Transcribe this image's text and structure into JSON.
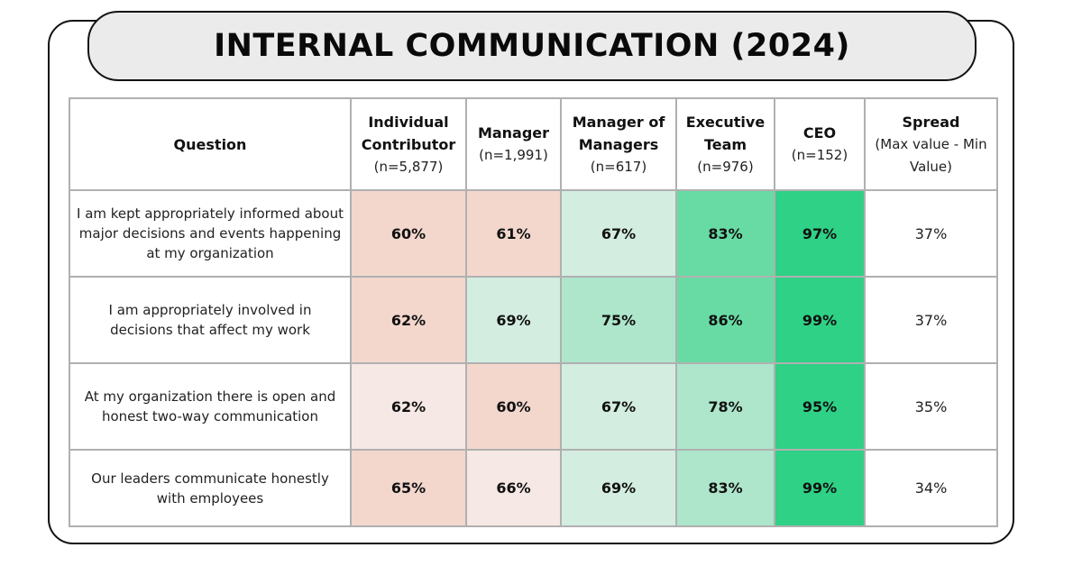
{
  "title": "INTERNAL COMMUNICATION (2024)",
  "colors": {
    "salmon": "#f3d7cd",
    "light_pink": "#f6e8e4",
    "pale_green": "#d3ede0",
    "mid_green": "#ade6cb",
    "green": "#68dba4",
    "strong_green": "#2ed185"
  },
  "columns": [
    {
      "name": "Question",
      "n": ""
    },
    {
      "name": "Individual Contributor",
      "n": "(n=5,877)"
    },
    {
      "name": "Manager",
      "n": "(n=1,991)"
    },
    {
      "name": "Manager of Managers",
      "n": "(n=617)"
    },
    {
      "name": "Executive Team",
      "n": "(n=976)"
    },
    {
      "name": "CEO",
      "n": "(n=152)"
    },
    {
      "name": "Spread",
      "n": "(Max value - Min Value)"
    }
  ],
  "rows": [
    {
      "question": "I am kept appropriately informed about major decisions and events happening at my organization",
      "values": [
        "60%",
        "61%",
        "67%",
        "83%",
        "97%"
      ],
      "colors": [
        "#f3d7cd",
        "#f3d7cd",
        "#d3ede0",
        "#68dba4",
        "#2ed185"
      ],
      "spread": "37%"
    },
    {
      "question": "I am appropriately involved in decisions that affect my work",
      "values": [
        "62%",
        "69%",
        "75%",
        "86%",
        "99%"
      ],
      "colors": [
        "#f3d7cd",
        "#d3ede0",
        "#ade6cb",
        "#68dba4",
        "#2ed185"
      ],
      "spread": "37%"
    },
    {
      "question": "At my organization there is open and honest two-way communication",
      "values": [
        "62%",
        "60%",
        "67%",
        "78%",
        "95%"
      ],
      "colors": [
        "#f6e8e4",
        "#f3d7cd",
        "#d3ede0",
        "#ade6cb",
        "#2ed185"
      ],
      "spread": "35%"
    },
    {
      "question": "Our leaders communicate honestly with employees",
      "values": [
        "65%",
        "66%",
        "69%",
        "83%",
        "99%"
      ],
      "colors": [
        "#f3d7cd",
        "#f6e8e4",
        "#d3ede0",
        "#ade6cb",
        "#2ed185"
      ],
      "spread": "34%"
    }
  ],
  "chart_data": {
    "type": "heatmap",
    "title": "INTERNAL COMMUNICATION (2024)",
    "x": [
      "Individual Contributor (n=5,877)",
      "Manager (n=1,991)",
      "Manager of Managers (n=617)",
      "Executive Team (n=976)",
      "CEO (n=152)"
    ],
    "y": [
      "I am kept appropriately informed about major decisions and events happening at my organization",
      "I am appropriately involved in decisions that affect my work",
      "At my organization there is open and honest two-way communication",
      "Our leaders communicate honestly with employees"
    ],
    "values": [
      [
        60,
        61,
        67,
        83,
        97
      ],
      [
        62,
        69,
        75,
        86,
        99
      ],
      [
        62,
        60,
        67,
        78,
        95
      ],
      [
        65,
        66,
        69,
        83,
        99
      ]
    ],
    "unit": "%",
    "extra_column": {
      "name": "Spread (Max value - Min Value)",
      "values": [
        37,
        37,
        35,
        34
      ]
    }
  }
}
